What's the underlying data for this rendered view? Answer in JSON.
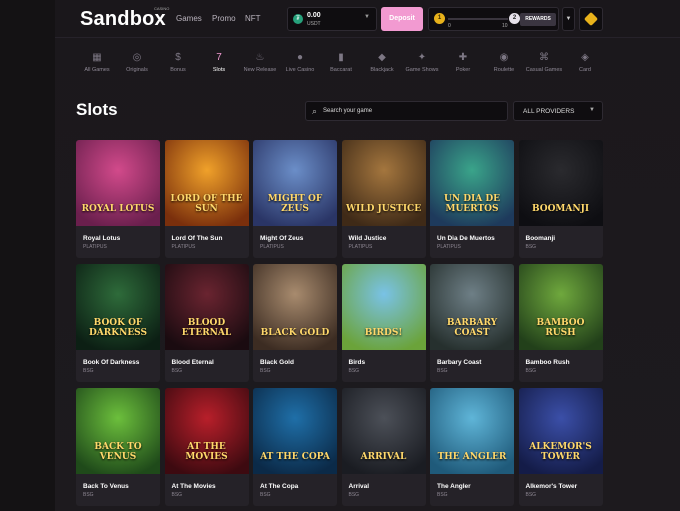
{
  "header": {
    "logo": "Sandbox",
    "logo_sub": "CASINO",
    "nav": [
      "Games",
      "Promo",
      "NFT"
    ],
    "balance": {
      "coin_symbol": "₮",
      "amount": "0.00",
      "currency": "USDT"
    },
    "deposit_label": "Deposit",
    "level": {
      "current": "1",
      "next": "2",
      "min": "0",
      "max": "10",
      "progress_percent": 0
    },
    "rewards_label": "REWARDS"
  },
  "categories": [
    {
      "label": "All Games",
      "icon": "grid-icon"
    },
    {
      "label": "Originals",
      "icon": "originals-icon"
    },
    {
      "label": "Bonus",
      "icon": "bonus-bag-icon"
    },
    {
      "label": "Slots",
      "icon": "slots-777-icon",
      "active": true
    },
    {
      "label": "New Release",
      "icon": "flame-icon"
    },
    {
      "label": "Live Casino",
      "icon": "live-casino-icon"
    },
    {
      "label": "Baccarat",
      "icon": "baccarat-cards-icon"
    },
    {
      "label": "Blackjack",
      "icon": "blackjack-icon"
    },
    {
      "label": "Game Shows",
      "icon": "game-shows-icon"
    },
    {
      "label": "Poker",
      "icon": "poker-chip-icon"
    },
    {
      "label": "Roulette",
      "icon": "roulette-icon"
    },
    {
      "label": "Casual Games",
      "icon": "gamepad-icon"
    },
    {
      "label": "Card",
      "icon": "card-icon"
    }
  ],
  "page": {
    "title": "Slots",
    "search_placeholder": "Search your game",
    "provider_filter": "ALL PROVIDERS"
  },
  "games": [
    {
      "name": "Royal Lotus",
      "provider": "PLATIPUS",
      "art_title": "ROYAL LOTUS",
      "colors": [
        "#d24a8b",
        "#6a1f4d"
      ]
    },
    {
      "name": "Lord Of The Sun",
      "provider": "PLATIPUS",
      "art_title": "LORD OF THE SUN",
      "colors": [
        "#f0a12a",
        "#7a2f0c"
      ]
    },
    {
      "name": "Might Of Zeus",
      "provider": "PLATIPUS",
      "art_title": "MIGHT OF ZEUS",
      "colors": [
        "#6b8ec8",
        "#2a3566"
      ]
    },
    {
      "name": "Wild Justice",
      "provider": "PLATIPUS",
      "art_title": "WILD JUSTICE",
      "colors": [
        "#a4763e",
        "#3f2a17"
      ]
    },
    {
      "name": "Un Dia De Muertos",
      "provider": "PLATIPUS",
      "art_title": "UN DIA DE MUERTOS",
      "colors": [
        "#3aa48a",
        "#1e3a5c"
      ]
    },
    {
      "name": "Boomanji",
      "provider": "BSG",
      "art_title": "BOOMANJI",
      "colors": [
        "#2a2a2e",
        "#0e0e12"
      ]
    },
    {
      "name": "Book Of Darkness",
      "provider": "BSG",
      "art_title": "BOOK OF DARKNESS",
      "colors": [
        "#2e6b3a",
        "#0c1f14"
      ]
    },
    {
      "name": "Blood Eternal",
      "provider": "BSG",
      "art_title": "BLOOD ETERNAL",
      "colors": [
        "#6a2430",
        "#1a0b10"
      ]
    },
    {
      "name": "Black Gold",
      "provider": "BSG",
      "art_title": "BLACK GOLD",
      "colors": [
        "#a88b6e",
        "#3c2c22"
      ]
    },
    {
      "name": "Birds",
      "provider": "BSG",
      "art_title": "BIRDS!",
      "colors": [
        "#79c2e6",
        "#6ba33a"
      ]
    },
    {
      "name": "Barbary Coast",
      "provider": "BSG",
      "art_title": "BARBARY COAST",
      "colors": [
        "#6e7f86",
        "#26302e"
      ]
    },
    {
      "name": "Bamboo Rush",
      "provider": "BSG",
      "art_title": "BAMBOO RUSH",
      "colors": [
        "#6fa83d",
        "#22401a"
      ]
    },
    {
      "name": "Back To Venus",
      "provider": "BSG",
      "art_title": "BACK TO VENUS",
      "colors": [
        "#6cbf3c",
        "#1f4a1a"
      ]
    },
    {
      "name": "At The Movies",
      "provider": "BSG",
      "art_title": "AT THE MOVIES",
      "colors": [
        "#b81f2a",
        "#3d0a10"
      ]
    },
    {
      "name": "At The Copa",
      "provider": "BSG",
      "art_title": "AT THE COPA",
      "colors": [
        "#1f6fa8",
        "#0b2a48"
      ]
    },
    {
      "name": "Arrival",
      "provider": "BSG",
      "art_title": "ARRIVAL",
      "colors": [
        "#4c5058",
        "#1a1c22"
      ]
    },
    {
      "name": "The Angler",
      "provider": "BSG",
      "art_title": "THE ANGLER",
      "colors": [
        "#5fb5d8",
        "#1f5a7a"
      ]
    },
    {
      "name": "Alkemor's Tower",
      "provider": "BSG",
      "art_title": "ALKEMOR'S TOWER",
      "colors": [
        "#3b4fa8",
        "#141c48"
      ]
    }
  ],
  "colors": {
    "accent": "#f29ad1",
    "background": "#1b181c",
    "card": "#252228"
  }
}
